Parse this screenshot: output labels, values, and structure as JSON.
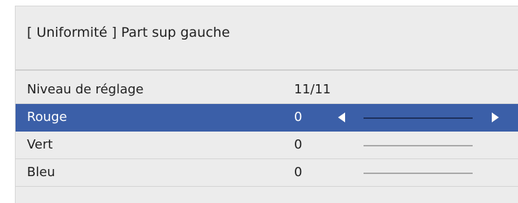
{
  "header": {
    "title": "[ Uniformité ] Part sup gauche"
  },
  "rows": [
    {
      "label": "Niveau de réglage",
      "value": "11/11"
    },
    {
      "label": "Rouge",
      "value": "0"
    },
    {
      "label": "Vert",
      "value": "0"
    },
    {
      "label": "Bleu",
      "value": "0"
    }
  ],
  "colors": {
    "panel_bg": "#ececec",
    "selected_bg": "#3b5fa8",
    "selected_text": "#ffffff"
  },
  "icons": {
    "decrease": "left-arrow-icon",
    "increase": "right-arrow-icon"
  }
}
